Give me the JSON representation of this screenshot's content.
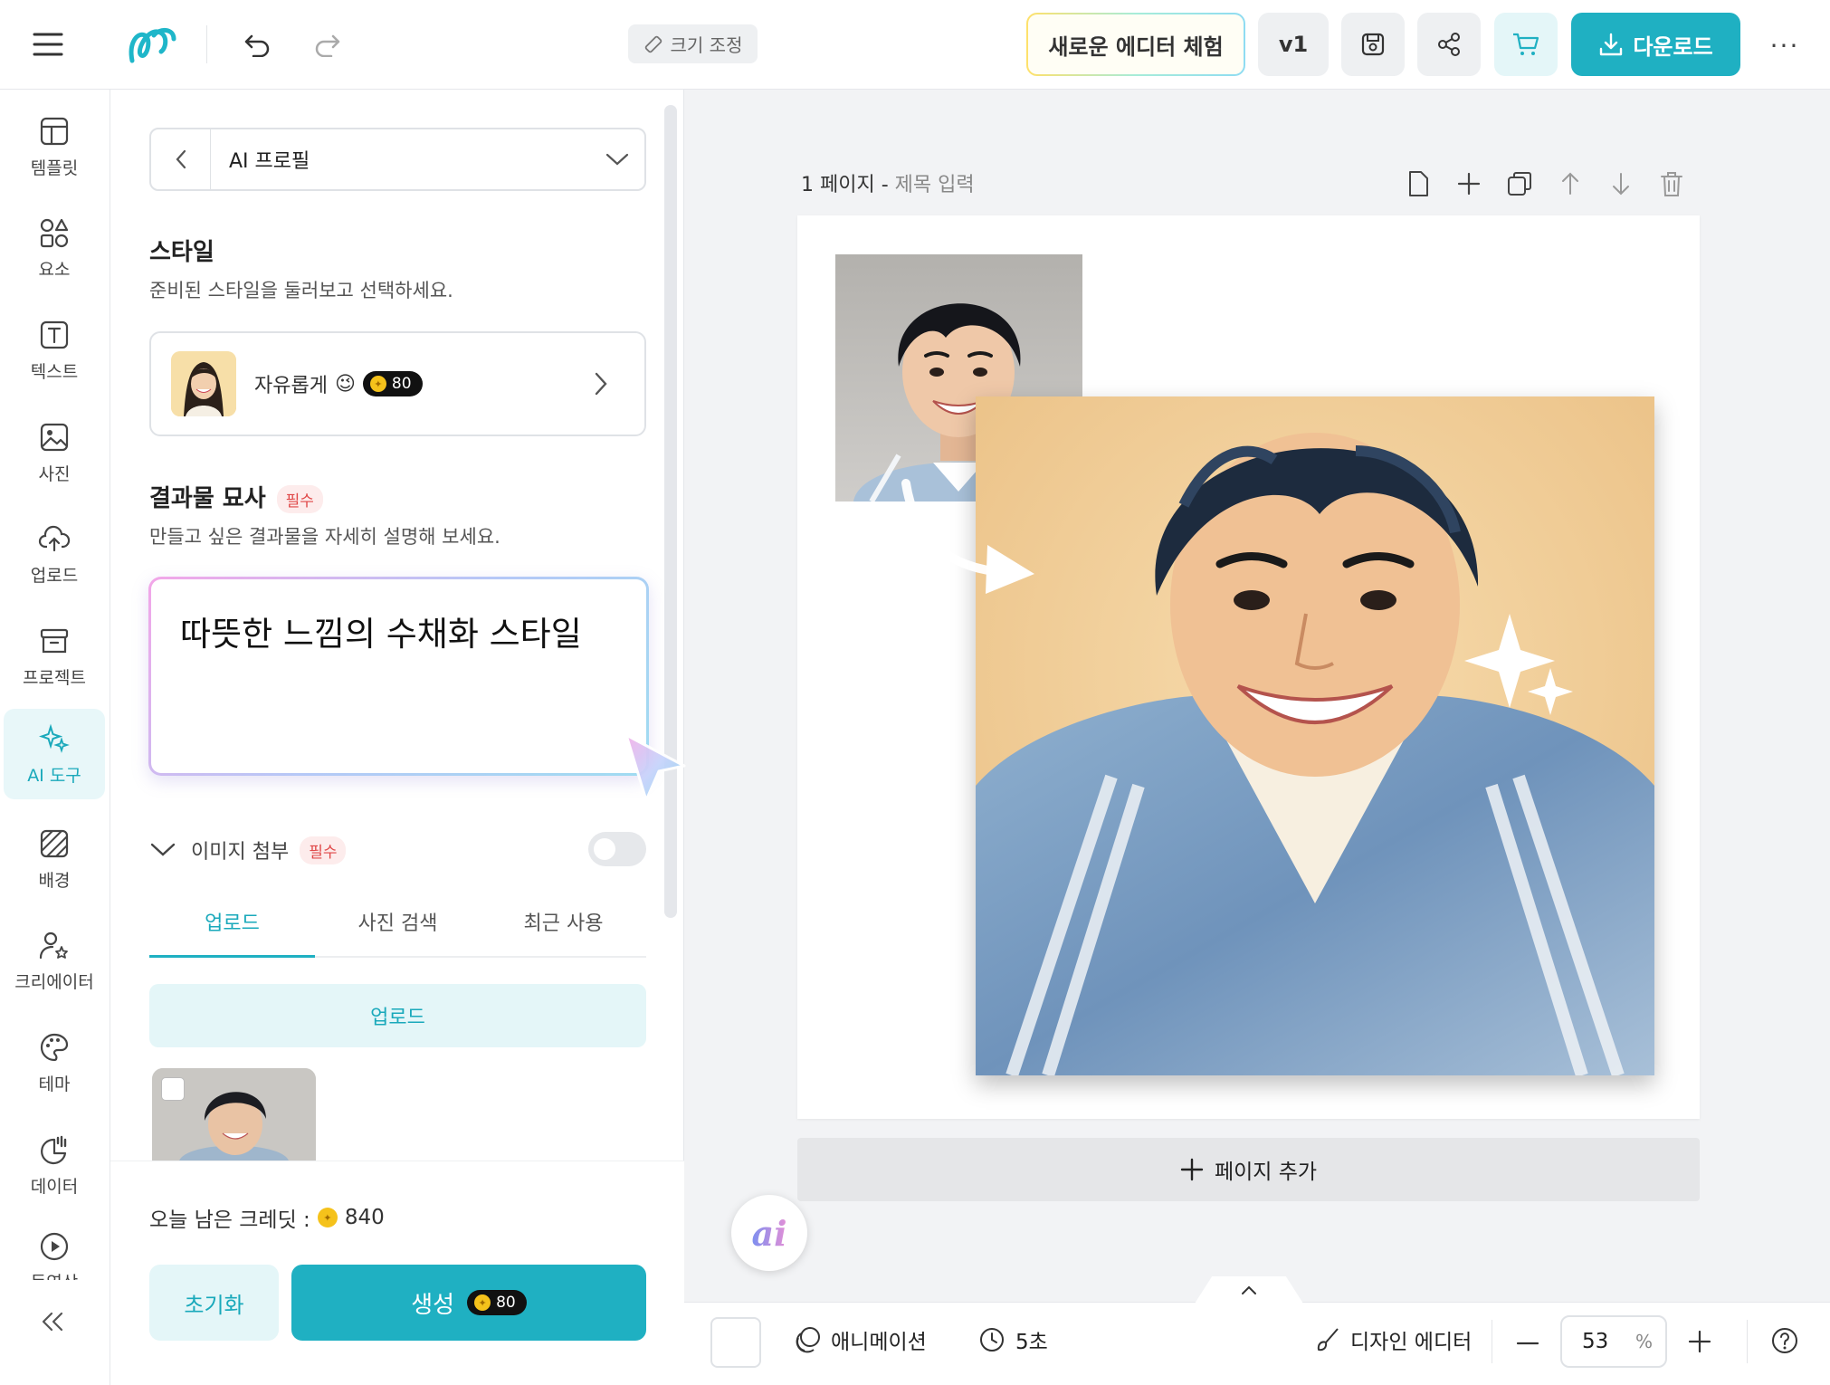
{
  "toolbar": {
    "resize_label": "크기 조정",
    "new_editor_label": "새로운 에디터 체험",
    "version_label": "v1",
    "download_label": "다운로드",
    "more_label": "···"
  },
  "leftnav": {
    "items": [
      {
        "label": "템플릿",
        "icon": "layout-icon"
      },
      {
        "label": "요소",
        "icon": "shapes-icon"
      },
      {
        "label": "텍스트",
        "icon": "text-icon"
      },
      {
        "label": "사진",
        "icon": "image-icon"
      },
      {
        "label": "업로드",
        "icon": "cloud-upload-icon"
      },
      {
        "label": "프로젝트",
        "icon": "archive-icon"
      },
      {
        "label": "AI 도구",
        "icon": "sparkle-icon",
        "active": true
      },
      {
        "label": "배경",
        "icon": "background-icon"
      },
      {
        "label": "크리에이터",
        "icon": "creator-icon"
      },
      {
        "label": "테마",
        "icon": "palette-icon"
      },
      {
        "label": "데이터",
        "icon": "chart-icon"
      },
      {
        "label": "동영상",
        "icon": "play-icon"
      }
    ]
  },
  "panel": {
    "tool_select": "AI 프로필",
    "style_title": "스타일",
    "style_sub": "준비된 스타일을 둘러보고 선택하세요.",
    "style_name": "자유롭게",
    "style_emoji": "😉",
    "style_cost": "80",
    "desc_title": "결과물 묘사",
    "required_badge": "필수",
    "desc_sub": "만들고 싶은 결과물을 자세히 설명해 보세요.",
    "desc_text": "따뜻한 느낌의 수채화 스타일",
    "attach_label": "이미지 첨부",
    "attach_toggle": false,
    "tabs": [
      "업로드",
      "사진 검색",
      "최근 사용"
    ],
    "active_tab": "업로드",
    "upload_button": "업로드",
    "credits_label": "오늘 남은 크레딧 :",
    "credits_value": "840",
    "reset_label": "초기화",
    "generate_label": "생성",
    "generate_cost": "80"
  },
  "canvas": {
    "page_number": "1 페이지 -",
    "page_title_placeholder": "제목 입력",
    "add_page_label": "페이지 추가",
    "ai_fab_label": "ai"
  },
  "bottombar": {
    "animation_label": "애니메이션",
    "duration_label": "5초",
    "design_editor_label": "디자인 에디터",
    "zoom_value": "53",
    "zoom_unit": "%"
  },
  "colors": {
    "accent": "#1fb0c2",
    "accent_light": "#e4f6f8",
    "required_red": "#e04848"
  }
}
